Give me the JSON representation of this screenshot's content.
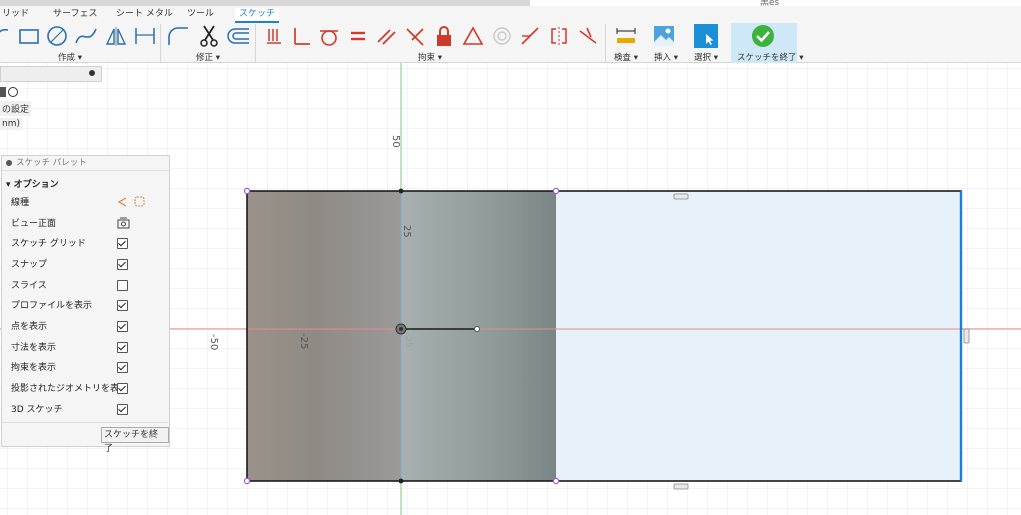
{
  "title_right": "黒es",
  "tabs": [
    {
      "label": "リッド"
    },
    {
      "label": "サーフェス"
    },
    {
      "label": "シート メタル"
    },
    {
      "label": "ツール"
    },
    {
      "label": "スケッチ"
    }
  ],
  "groups": {
    "create": "作成 ▾",
    "modify": "修正 ▾",
    "constraints": "拘束 ▾",
    "inspect": "検査 ▾",
    "insert": "挿入 ▾",
    "select": "選択 ▾",
    "finish": "スケッチを終了 ▾"
  },
  "browser": {
    "row1": "の設定",
    "row2": "nm)"
  },
  "palette": {
    "header": "スケッチ パレット",
    "section": "▾ オプション",
    "rows": [
      {
        "label": "線種",
        "checked": null
      },
      {
        "label": "ビュー正面",
        "checked": null
      },
      {
        "label": "スケッチ グリッド",
        "checked": true
      },
      {
        "label": "スナップ",
        "checked": true
      },
      {
        "label": "スライス",
        "checked": false
      },
      {
        "label": "プロファイルを表示",
        "checked": true
      },
      {
        "label": "点を表示",
        "checked": true
      },
      {
        "label": "寸法を表示",
        "checked": true
      },
      {
        "label": "拘束を表示",
        "checked": true
      },
      {
        "label": "投影されたジオメトリを表示",
        "checked": true
      },
      {
        "label": "3D スケッチ",
        "checked": true
      }
    ],
    "finish_button": "スケッチを終了"
  },
  "canvas": {
    "axis_labels": {
      "top": "50",
      "left": "-50",
      "mid": "25",
      "minus25": "-25",
      "origin": "-25"
    }
  },
  "colors": {
    "accent": "#1a82d4",
    "finish_bg": "#cfe8f7",
    "grid": "#e6e6e6",
    "axis_x": "#e06060",
    "axis_y": "#7acc7a"
  }
}
